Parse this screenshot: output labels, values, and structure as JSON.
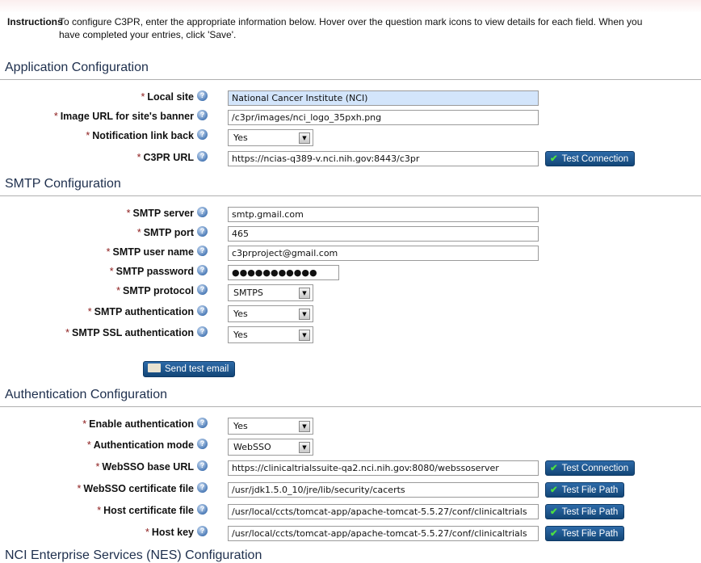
{
  "instructions": {
    "label": "Instructions",
    "text": "To configure C3PR, enter the appropriate information below. Hover over the question mark icons to view details for each field. When you have completed your entries, click 'Save'."
  },
  "sections": {
    "app": {
      "title": "Application Configuration",
      "local_site": {
        "label": "Local site",
        "value": "National Cancer Institute (NCI)"
      },
      "banner": {
        "label": "Image URL for site's banner",
        "value": "/c3pr/images/nci_logo_35pxh.png"
      },
      "notif": {
        "label": "Notification link back",
        "value": "Yes"
      },
      "url": {
        "label": "C3PR URL",
        "value": "https://ncias-q389-v.nci.nih.gov:8443/c3pr",
        "button": "Test Connection"
      }
    },
    "smtp": {
      "title": "SMTP Configuration",
      "server": {
        "label": "SMTP server",
        "value": "smtp.gmail.com"
      },
      "port": {
        "label": "SMTP port",
        "value": "465"
      },
      "user": {
        "label": "SMTP user name",
        "value": "c3prproject@gmail.com"
      },
      "password": {
        "label": "SMTP password",
        "value": "●●●●●●●●●●●"
      },
      "protocol": {
        "label": "SMTP protocol",
        "value": "SMTPS"
      },
      "auth": {
        "label": "SMTP authentication",
        "value": "Yes"
      },
      "ssl": {
        "label": "SMTP SSL authentication",
        "value": "Yes"
      },
      "send_button": "Send test email"
    },
    "auth": {
      "title": "Authentication Configuration",
      "enable": {
        "label": "Enable authentication",
        "value": "Yes"
      },
      "mode": {
        "label": "Authentication mode",
        "value": "WebSSO"
      },
      "base": {
        "label": "WebSSO base URL",
        "value": "https://clinicaltrialssuite-qa2.nci.nih.gov:8080/webssoserver",
        "button": "Test Connection"
      },
      "cert": {
        "label": "WebSSO certificate file",
        "value": "/usr/jdk1.5.0_10/jre/lib/security/cacerts",
        "button": "Test File Path"
      },
      "hostcert": {
        "label": "Host certificate file",
        "value": "/usr/local/ccts/tomcat-app/apache-tomcat-5.5.27/conf/clinicaltrials",
        "button": "Test File Path"
      },
      "hostkey": {
        "label": "Host key",
        "value": "/usr/local/ccts/tomcat-app/apache-tomcat-5.5.27/conf/clinicaltrials",
        "button": "Test File Path"
      }
    },
    "nes": {
      "title": "NCI Enterprise Services (NES) Configuration"
    }
  },
  "common": {
    "required": "*",
    "help": "?",
    "dropdown": "▼"
  }
}
